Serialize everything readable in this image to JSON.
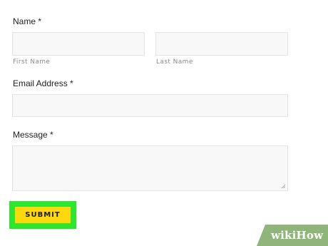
{
  "form": {
    "name_label": "Name *",
    "first_name_sublabel": "First Name",
    "last_name_sublabel": "Last Name",
    "email_label": "Email Address *",
    "message_label": "Message *",
    "first_name_value": "",
    "last_name_value": "",
    "email_value": "",
    "message_value": "",
    "submit_label": "SUBMIT"
  },
  "colors": {
    "submit_button": "#fcd80c",
    "highlight_outline": "#2ee62e",
    "field_background": "#f8f8f8",
    "field_border": "#e4e4e4",
    "watermark_green": "#8fb57a"
  },
  "watermark": {
    "wiki": "wiki",
    "how": "How"
  }
}
